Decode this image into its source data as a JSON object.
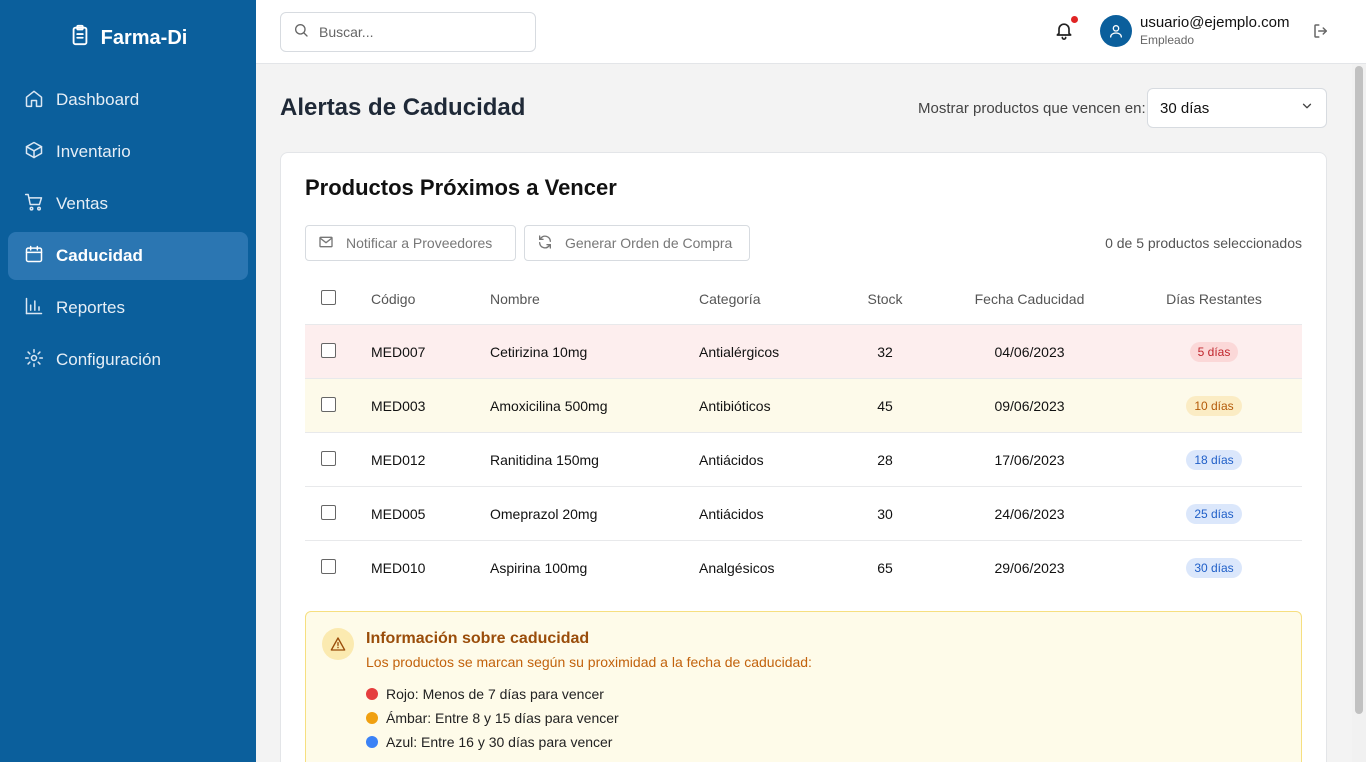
{
  "brand": {
    "name": "Farma-Di",
    "icon": "clipboard-icon"
  },
  "sidebar": {
    "items": [
      {
        "label": "Dashboard",
        "icon": "home-icon"
      },
      {
        "label": "Inventario",
        "icon": "box-icon"
      },
      {
        "label": "Ventas",
        "icon": "cart-icon"
      },
      {
        "label": "Caducidad",
        "icon": "calendar-icon",
        "active": true
      },
      {
        "label": "Reportes",
        "icon": "bar-chart-icon"
      },
      {
        "label": "Configuración",
        "icon": "gear-icon"
      }
    ]
  },
  "topbar": {
    "search_placeholder": "Buscar...",
    "user_email": "usuario@ejemplo.com",
    "user_role": "Empleado"
  },
  "page": {
    "title": "Alertas de Caducidad",
    "filter_label": "Mostrar productos que vencen en:",
    "filter_value": "30 días"
  },
  "card": {
    "title": "Productos Próximos a Vencer",
    "notify_button": "Notificar a Proveedores",
    "order_button": "Generar Orden de Compra",
    "selected_count": "0 de 5 productos seleccionados"
  },
  "table": {
    "headers": {
      "code": "Código",
      "name": "Nombre",
      "category": "Categoría",
      "stock": "Stock",
      "date": "Fecha Caducidad",
      "days": "Días Restantes"
    },
    "rows": [
      {
        "code": "MED007",
        "name": "Cetirizina 10mg",
        "category": "Antialérgicos",
        "stock": "32",
        "date": "04/06/2023",
        "days": "5 días",
        "level": "red"
      },
      {
        "code": "MED003",
        "name": "Amoxicilina 500mg",
        "category": "Antibióticos",
        "stock": "45",
        "date": "09/06/2023",
        "days": "10 días",
        "level": "amber"
      },
      {
        "code": "MED012",
        "name": "Ranitidina 150mg",
        "category": "Antiácidos",
        "stock": "28",
        "date": "17/06/2023",
        "days": "18 días",
        "level": "blue"
      },
      {
        "code": "MED005",
        "name": "Omeprazol 20mg",
        "category": "Antiácidos",
        "stock": "30",
        "date": "24/06/2023",
        "days": "25 días",
        "level": "blue"
      },
      {
        "code": "MED010",
        "name": "Aspirina 100mg",
        "category": "Analgésicos",
        "stock": "65",
        "date": "29/06/2023",
        "days": "30 días",
        "level": "blue"
      }
    ]
  },
  "info": {
    "title": "Información sobre caducidad",
    "text": "Los productos se marcan según su proximidad a la fecha de caducidad:",
    "legend": [
      {
        "label": "Rojo: Menos de 7 días para vencer",
        "color": "#e53e3e"
      },
      {
        "label": "Ámbar: Entre 8 y 15 días para vencer",
        "color": "#f0a010"
      },
      {
        "label": "Azul: Entre 16 y 30 días para vencer",
        "color": "#3b82f6"
      }
    ]
  },
  "colors": {
    "sidebar_bg": "#0b5f9c",
    "sidebar_active": "#2b76b2"
  }
}
